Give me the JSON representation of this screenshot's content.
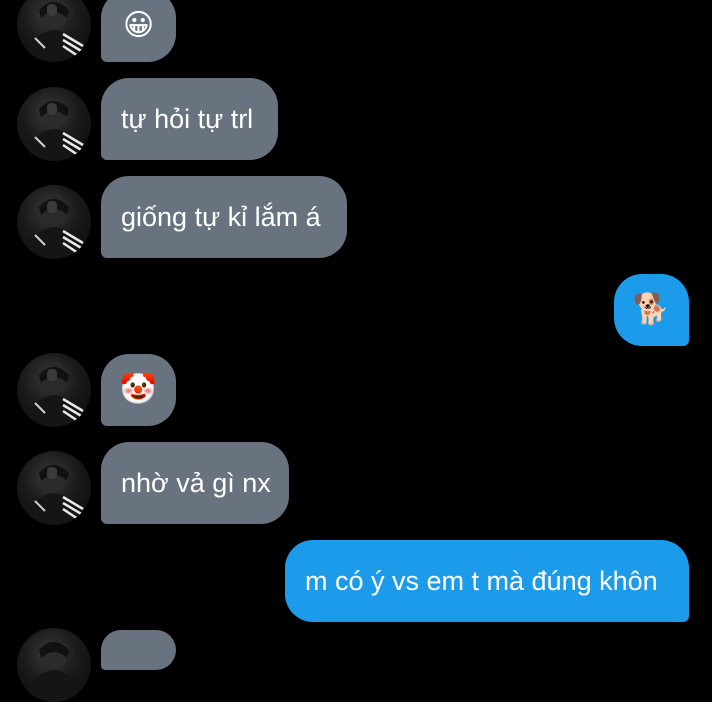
{
  "colors": {
    "background": "#000000",
    "incoming_bubble": "#68737f",
    "outgoing_bubble": "#1c9bea",
    "text": "#ffffff"
  },
  "messages": [
    {
      "direction": "incoming",
      "text": "😀",
      "avatar_icon": "profile-photo-icon"
    },
    {
      "direction": "incoming",
      "text": "tự hỏi tự trl",
      "avatar_icon": "profile-photo-icon"
    },
    {
      "direction": "incoming",
      "text": "giống tự kỉ lắm á",
      "avatar_icon": "profile-photo-icon"
    },
    {
      "direction": "outgoing",
      "text": "🐕"
    },
    {
      "direction": "incoming",
      "text": "🤡",
      "avatar_icon": "profile-photo-icon"
    },
    {
      "direction": "incoming",
      "text": "nhờ vả gì nx",
      "avatar_icon": "profile-photo-icon"
    },
    {
      "direction": "outgoing",
      "text": "m có ý vs em t mà đúng khôn"
    },
    {
      "direction": "incoming",
      "text": "",
      "avatar_icon": "profile-photo-icon"
    }
  ]
}
